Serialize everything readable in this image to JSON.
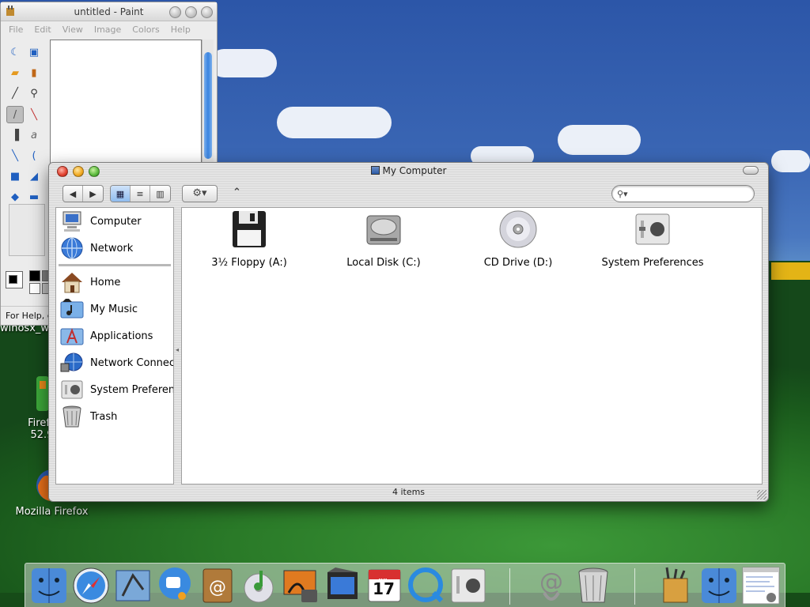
{
  "desktop": {
    "icons": [
      {
        "label_line1": "Firefo",
        "label_line2": "52.9"
      },
      {
        "label_line1": "Mozilla Firefox",
        "label_line2": ""
      }
    ],
    "hidden_label": "winosx_w"
  },
  "paint": {
    "title": "untitled - Paint",
    "menu": [
      "File",
      "Edit",
      "View",
      "Image",
      "Colors",
      "Help"
    ],
    "status": "For Help, c"
  },
  "finder": {
    "title": "My Computer",
    "search": {
      "value": "",
      "placeholder": ""
    },
    "sidebar": [
      {
        "label": "Computer",
        "icon": "computer-icon"
      },
      {
        "label": "Network",
        "icon": "network-globe-icon"
      },
      {
        "label": "Home",
        "icon": "home-house-icon"
      },
      {
        "label": "My Music",
        "icon": "music-folder-icon"
      },
      {
        "label": "Applications",
        "icon": "applications-folder-icon"
      },
      {
        "label": "Network Connec",
        "icon": "network-connections-icon"
      },
      {
        "label": "System Preferenc",
        "icon": "system-preferences-icon"
      },
      {
        "label": "Trash",
        "icon": "trash-icon"
      }
    ],
    "volumes": [
      {
        "label": "3½ Floppy (A:)",
        "icon": "floppy-disk-icon"
      },
      {
        "label": "Local Disk (C:)",
        "icon": "hard-disk-icon"
      },
      {
        "label": "CD Drive (D:)",
        "icon": "cd-drive-icon"
      },
      {
        "label": "System Preferences",
        "icon": "system-preferences-icon"
      }
    ],
    "status": "4 items"
  },
  "dock": {
    "items": [
      "finder-icon",
      "safari-icon",
      "mail-icon",
      "ichat-icon",
      "address-book-icon",
      "itunes-icon",
      "iphoto-icon",
      "imovie-icon",
      "ical-icon",
      "quicktime-icon",
      "system-preferences-icon",
      "mail-at-icon",
      "trash-icon",
      "utilities-icon",
      "finder-icon",
      "window-thumbnail-icon"
    ],
    "ical_date": "17",
    "ical_month": "JUL"
  }
}
